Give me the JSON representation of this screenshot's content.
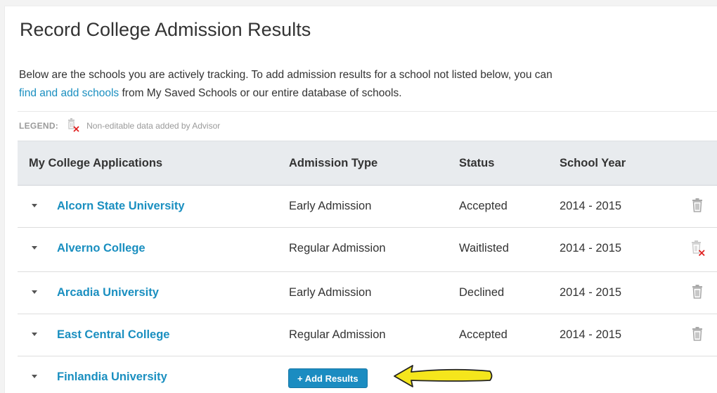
{
  "page": {
    "title": "Record College Admission Results",
    "intro_before": "Below are the schools you are actively tracking. To add admission results for a school not listed below, you can",
    "intro_link": "find and add schools",
    "intro_after": " from My Saved Schools or our entire database of schools."
  },
  "legend": {
    "label": "LEGEND:",
    "text": "Non-editable data added by Advisor"
  },
  "table": {
    "columns": [
      "My College Applications",
      "Admission Type",
      "Status",
      "School Year"
    ],
    "rows": [
      {
        "school": "Alcorn State University",
        "type": "Early Admission",
        "status": "Accepted",
        "year": "2014 - 2015",
        "icon": "trash-icon"
      },
      {
        "school": "Alverno College",
        "type": "Regular Admission",
        "status": "Waitlisted",
        "year": "2014 - 2015",
        "icon": "non-editable-trash-icon"
      },
      {
        "school": "Arcadia University",
        "type": "Early Admission",
        "status": "Declined",
        "year": "2014 - 2015",
        "icon": "trash-icon"
      },
      {
        "school": "East Central College",
        "type": "Regular Admission",
        "status": "Accepted",
        "year": "2014 - 2015",
        "icon": "trash-icon"
      },
      {
        "school": "Finlandia University",
        "action": "+ Add Results"
      }
    ]
  },
  "colors": {
    "link": "#1a8fc0",
    "button": "#1b8cc1",
    "header_bg": "#e8ebee",
    "annotation_arrow": "#f5e61c",
    "non_editable_mark": "#e02020"
  }
}
